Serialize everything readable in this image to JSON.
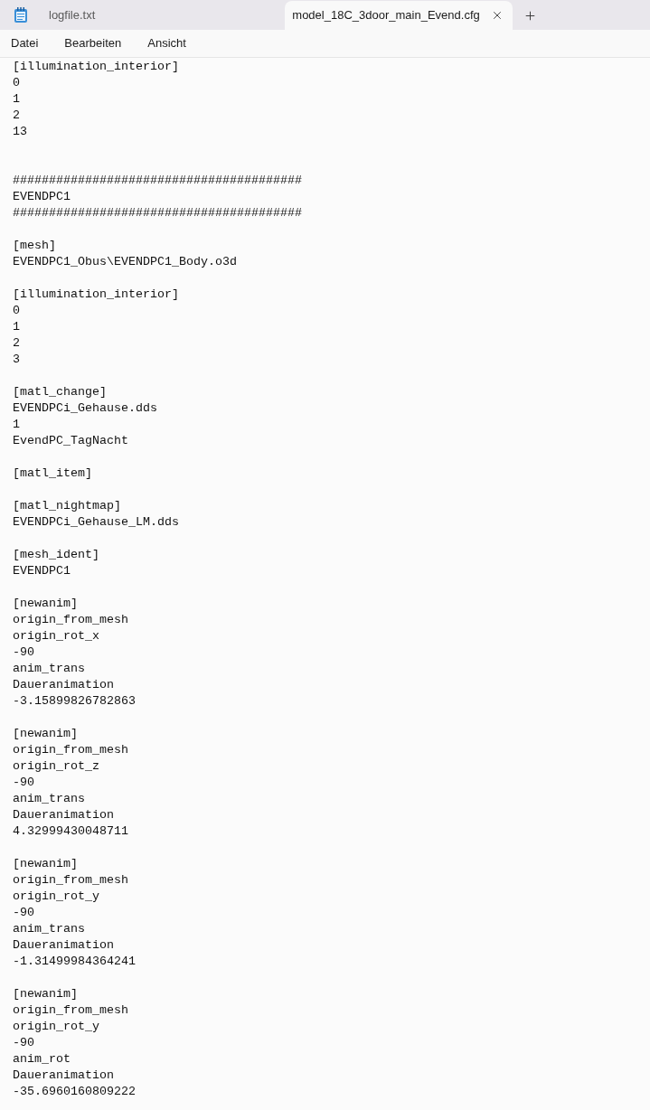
{
  "tabs": [
    {
      "label": "logfile.txt",
      "selected": false
    },
    {
      "label": "model_18C_3door_main_Evend.cfg",
      "selected": true
    }
  ],
  "menu": [
    "Datei",
    "Bearbeiten",
    "Ansicht"
  ],
  "editor": {
    "blocks": [
      {
        "lines": [
          "[illumination_interior]",
          "0",
          "1",
          "2",
          "13"
        ],
        "extra_space": true
      },
      {
        "lines": [
          "########################################",
          "EVENDPC1",
          "########################################"
        ],
        "extra_space": false
      },
      {
        "lines": [
          "[mesh]",
          "EVENDPC1_Obus\\EVENDPC1_Body.o3d"
        ],
        "extra_space": false
      },
      {
        "lines": [
          "[illumination_interior]",
          "0",
          "1",
          "2",
          "3"
        ],
        "extra_space": false
      },
      {
        "lines": [
          "[matl_change]",
          "EVENDPCi_Gehause.dds",
          "1",
          "EvendPC_TagNacht"
        ],
        "extra_space": false
      },
      {
        "lines": [
          "[matl_item]"
        ],
        "extra_space": false
      },
      {
        "lines": [
          "[matl_nightmap]",
          "EVENDPCi_Gehause_LM.dds"
        ],
        "extra_space": false
      },
      {
        "lines": [
          "[mesh_ident]",
          "EVENDPC1"
        ],
        "extra_space": false
      },
      {
        "lines": [
          "[newanim]",
          "origin_from_mesh",
          "origin_rot_x",
          "-90",
          "anim_trans",
          "Daueranimation",
          "-3.15899826782863"
        ],
        "extra_space": false
      },
      {
        "lines": [
          "[newanim]",
          "origin_from_mesh",
          "origin_rot_z",
          "-90",
          "anim_trans",
          "Daueranimation",
          "4.32999430048711"
        ],
        "extra_space": false
      },
      {
        "lines": [
          "[newanim]",
          "origin_from_mesh",
          "origin_rot_y",
          "-90",
          "anim_trans",
          "Daueranimation",
          "-1.31499984364241"
        ],
        "extra_space": false
      },
      {
        "lines": [
          "[newanim]",
          "origin_from_mesh",
          "origin_rot_y",
          "-90",
          "anim_rot",
          "Daueranimation",
          "-35.6960160809222"
        ],
        "extra_space": false
      }
    ]
  }
}
